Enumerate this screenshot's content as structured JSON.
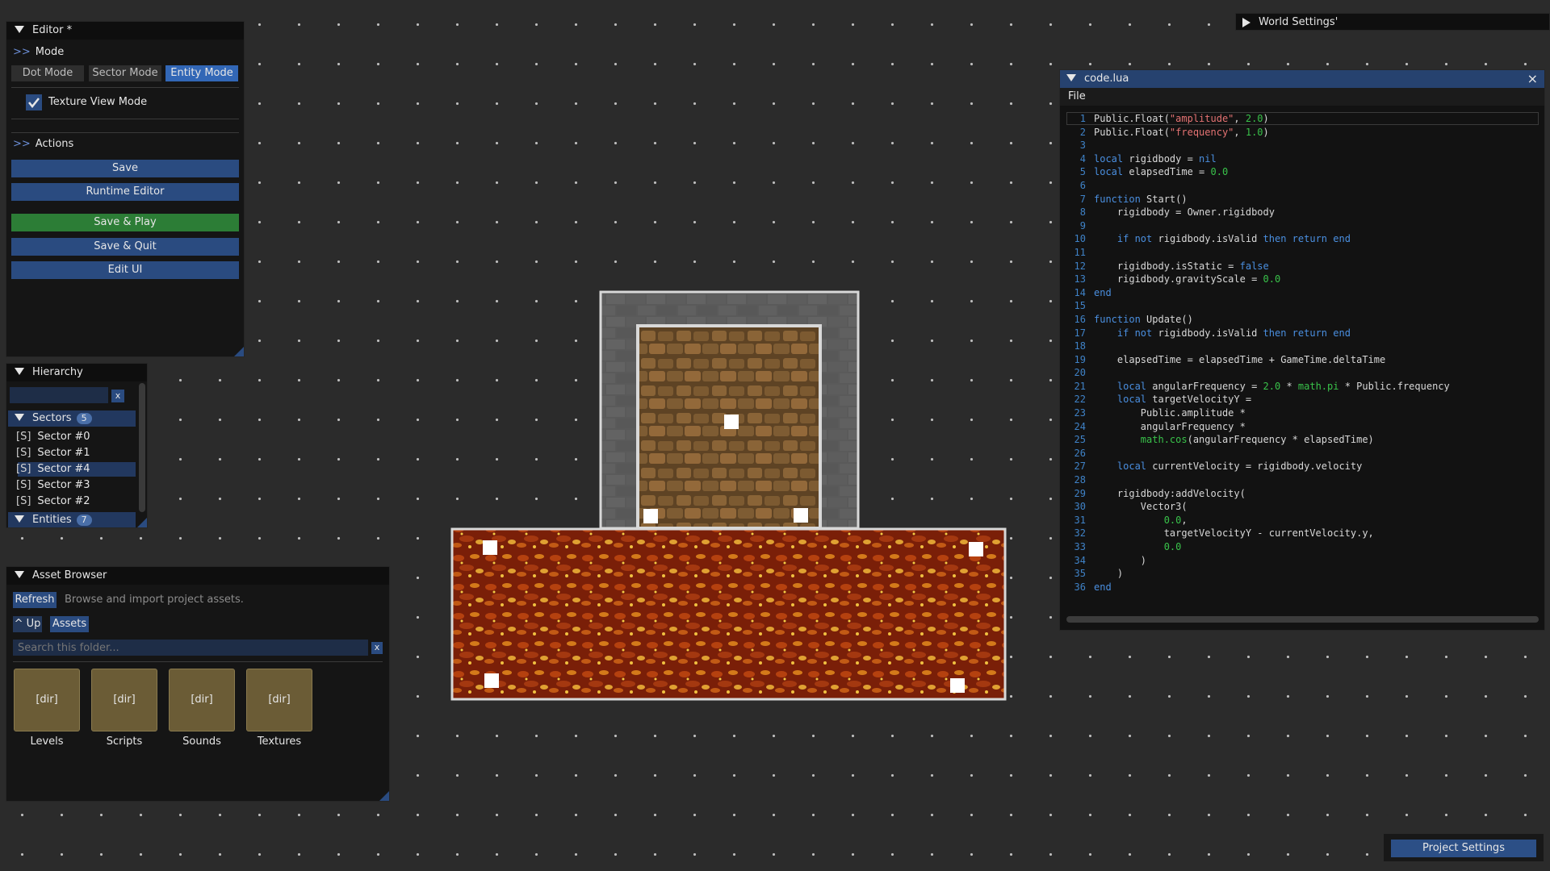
{
  "editor": {
    "title": "Editor *",
    "mode_header": "Mode",
    "modes": [
      "Dot Mode",
      "Sector Mode",
      "Entity Mode"
    ],
    "active_mode": "Entity Mode",
    "texture_view_label": "Texture View Mode",
    "texture_view_checked": true,
    "actions_header": "Actions",
    "actions": [
      "Save",
      "Runtime Editor",
      "Save & Play",
      "Save & Quit",
      "Edit UI"
    ],
    "arrows": ">>"
  },
  "hierarchy": {
    "title": "Hierarchy",
    "search_value": "",
    "clear_label": "x",
    "sectors_label": "Sectors",
    "sectors_count": "5",
    "sector_tag": "[S]",
    "sectors": [
      "Sector #0",
      "Sector #1",
      "Sector #4",
      "Sector #3",
      "Sector #2"
    ],
    "selected_sector": "Sector #4",
    "entities_label": "Entities",
    "entities_count": "7"
  },
  "asset_browser": {
    "title": "Asset Browser",
    "refresh_label": "Refresh",
    "hint": "Browse and import project assets.",
    "up_label": "^ Up",
    "breadcrumb": "Assets",
    "search_placeholder": "Search this folder...",
    "clear_label": "x",
    "dir_tag": "[dir]",
    "folders": [
      "Levels",
      "Scripts",
      "Sounds",
      "Textures"
    ]
  },
  "world_settings": {
    "title": "World Settings'"
  },
  "code_editor": {
    "title": "code.lua",
    "menu_file": "File",
    "close_label": "×",
    "lines": [
      [
        [
          "txt",
          "Public.Float("
        ],
        [
          "str",
          "\"amplitude\""
        ],
        [
          "txt",
          ", "
        ],
        [
          "num",
          "2.0"
        ],
        [
          "txt",
          ")"
        ]
      ],
      [
        [
          "txt",
          "Public.Float("
        ],
        [
          "str",
          "\"frequency\""
        ],
        [
          "txt",
          ", "
        ],
        [
          "num",
          "1.0"
        ],
        [
          "txt",
          ")"
        ]
      ],
      [],
      [
        [
          "kw",
          "local"
        ],
        [
          "txt",
          " rigidbody = "
        ],
        [
          "kw",
          "nil"
        ]
      ],
      [
        [
          "kw",
          "local"
        ],
        [
          "txt",
          " elapsedTime = "
        ],
        [
          "num",
          "0.0"
        ]
      ],
      [],
      [
        [
          "kw",
          "function"
        ],
        [
          "txt",
          " Start()"
        ]
      ],
      [
        [
          "txt",
          "    rigidbody = Owner.rigidbody"
        ]
      ],
      [],
      [
        [
          "txt",
          "    "
        ],
        [
          "kw",
          "if not"
        ],
        [
          "txt",
          " rigidbody.isValid "
        ],
        [
          "kw",
          "then return end"
        ]
      ],
      [],
      [
        [
          "txt",
          "    rigidbody.isStatic = "
        ],
        [
          "kw",
          "false"
        ]
      ],
      [
        [
          "txt",
          "    rigidbody.gravityScale = "
        ],
        [
          "num",
          "0.0"
        ]
      ],
      [
        [
          "kw",
          "end"
        ]
      ],
      [],
      [
        [
          "kw",
          "function"
        ],
        [
          "txt",
          " Update()"
        ]
      ],
      [
        [
          "txt",
          "    "
        ],
        [
          "kw",
          "if not"
        ],
        [
          "txt",
          " rigidbody.isValid "
        ],
        [
          "kw",
          "then return end"
        ]
      ],
      [],
      [
        [
          "txt",
          "    elapsedTime = elapsedTime + GameTime.deltaTime"
        ]
      ],
      [],
      [
        [
          "txt",
          "    "
        ],
        [
          "kw",
          "local"
        ],
        [
          "txt",
          " angularFrequency = "
        ],
        [
          "num",
          "2.0"
        ],
        [
          "txt",
          " * "
        ],
        [
          "num",
          "math.pi"
        ],
        [
          "txt",
          " * Public.frequency"
        ]
      ],
      [
        [
          "txt",
          "    "
        ],
        [
          "kw",
          "local"
        ],
        [
          "txt",
          " targetVelocityY ="
        ]
      ],
      [
        [
          "txt",
          "        Public.amplitude *"
        ]
      ],
      [
        [
          "txt",
          "        angularFrequency *"
        ]
      ],
      [
        [
          "txt",
          "        "
        ],
        [
          "num",
          "math.cos"
        ],
        [
          "txt",
          "(angularFrequency * elapsedTime)"
        ]
      ],
      [],
      [
        [
          "txt",
          "    "
        ],
        [
          "kw",
          "local"
        ],
        [
          "txt",
          " currentVelocity = rigidbody.velocity"
        ]
      ],
      [],
      [
        [
          "txt",
          "    rigidbody:addVelocity("
        ]
      ],
      [
        [
          "txt",
          "        Vector3("
        ]
      ],
      [
        [
          "txt",
          "            "
        ],
        [
          "num",
          "0.0"
        ],
        [
          "txt",
          ","
        ]
      ],
      [
        [
          "txt",
          "            targetVelocityY - currentVelocity.y,"
        ]
      ],
      [
        [
          "txt",
          "            "
        ],
        [
          "num",
          "0.0"
        ]
      ],
      [
        [
          "txt",
          "        )"
        ]
      ],
      [
        [
          "txt",
          "    )"
        ]
      ],
      [
        [
          "kw",
          "end"
        ]
      ]
    ]
  },
  "project_settings": {
    "label": "Project Settings"
  },
  "colors": {
    "accent_blue": "#2a4b80",
    "active_blue": "#3267b6",
    "play_green": "#2c7d36",
    "background": "#2b2b2b"
  }
}
